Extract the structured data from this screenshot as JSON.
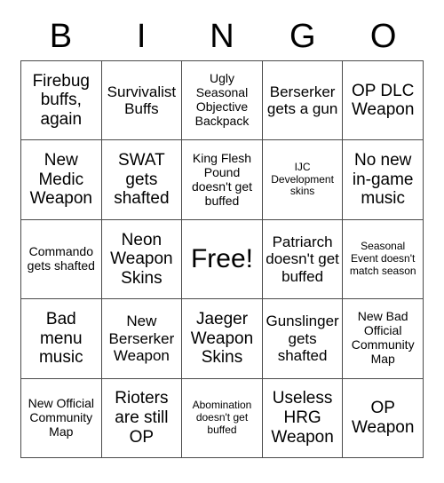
{
  "card": {
    "title": "BINGO",
    "header_letters": [
      "B",
      "I",
      "N",
      "G",
      "O"
    ],
    "colors": {
      "background": "#ffffff",
      "text": "#000000",
      "grid_line": "#4a4a4a"
    },
    "free_space_label": "Free!",
    "free_space_index": 12,
    "rows": 5,
    "columns": 5,
    "cells": [
      {
        "text": "Firebug buffs, again",
        "size": "lg"
      },
      {
        "text": "Survivalist Buffs",
        "size": "md"
      },
      {
        "text": "Ugly Seasonal Objective Backpack",
        "size": "sm"
      },
      {
        "text": "Berserker gets a gun",
        "size": "md"
      },
      {
        "text": "OP DLC Weapon",
        "size": "lg"
      },
      {
        "text": "New Medic Weapon",
        "size": "lg"
      },
      {
        "text": "SWAT gets shafted",
        "size": "lg"
      },
      {
        "text": "King Flesh Pound doesn't get buffed",
        "size": "sm"
      },
      {
        "text": "IJC Development skins",
        "size": "xs"
      },
      {
        "text": "No new in-game music",
        "size": "lg"
      },
      {
        "text": "Commando gets shafted",
        "size": "sm"
      },
      {
        "text": "Neon Weapon Skins",
        "size": "lg"
      },
      {
        "text": "Free!",
        "size": "xl"
      },
      {
        "text": "Patriarch doesn't get buffed",
        "size": "md"
      },
      {
        "text": "Seasonal Event doesn't match season",
        "size": "xs"
      },
      {
        "text": "Bad menu music",
        "size": "lg"
      },
      {
        "text": "New Berserker Weapon",
        "size": "md"
      },
      {
        "text": "Jaeger Weapon Skins",
        "size": "lg"
      },
      {
        "text": "Gunslinger gets shafted",
        "size": "md"
      },
      {
        "text": "New Bad Official Community Map",
        "size": "sm"
      },
      {
        "text": "New Official Community Map",
        "size": "sm"
      },
      {
        "text": "Rioters are still OP",
        "size": "lg"
      },
      {
        "text": "Abomination doesn't get buffed",
        "size": "xs"
      },
      {
        "text": "Useless HRG Weapon",
        "size": "lg"
      },
      {
        "text": "OP Weapon",
        "size": "lg"
      }
    ]
  }
}
